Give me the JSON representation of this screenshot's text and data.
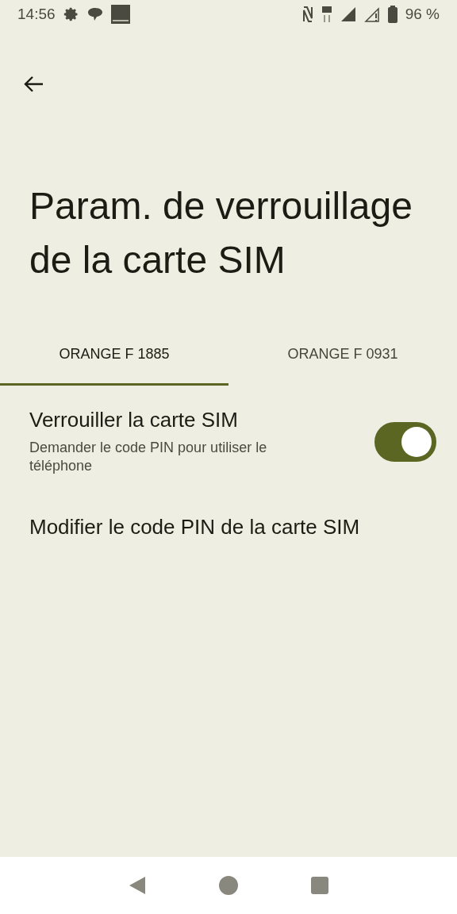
{
  "status_bar": {
    "time": "14:56",
    "battery": "96 %"
  },
  "title": "Param. de verrouillage de la carte SIM",
  "tabs": [
    {
      "label": "ORANGE F 1885",
      "selected": true
    },
    {
      "label": "ORANGE F 0931",
      "selected": false
    }
  ],
  "settings": [
    {
      "kind": "toggle",
      "title": "Verrouiller la carte SIM",
      "summary": "Demander le code PIN pour utiliser le téléphone",
      "on": true
    },
    {
      "kind": "plain",
      "title": "Modifier le code PIN de la carte SIM"
    }
  ]
}
